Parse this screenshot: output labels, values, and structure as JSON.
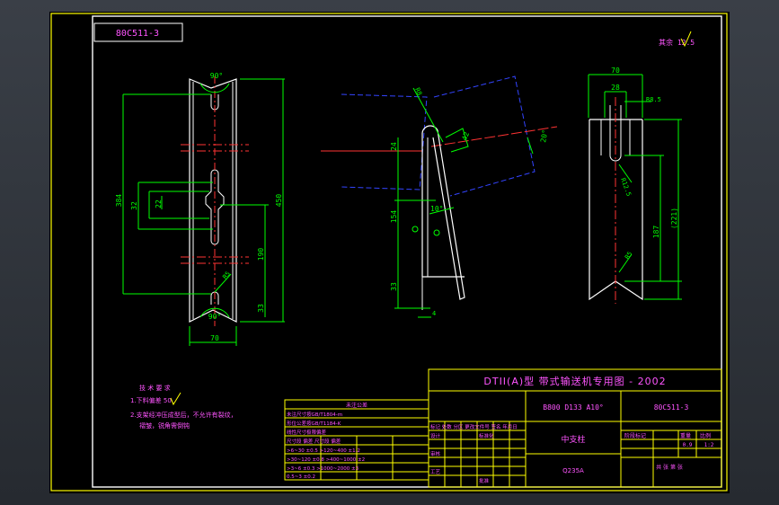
{
  "sheet": {
    "code_mirrored": "80C511-3",
    "roughness_note": "其余 12.5"
  },
  "front_view": {
    "angle_top": "90°",
    "angle_bottom": "90°",
    "width": "70",
    "hole_span": "384",
    "total_height": "450",
    "slot_width": "32",
    "slot_inner": "22",
    "lower_span": "190",
    "bottom_offset": "33",
    "radius": "R5"
  },
  "side_view": {
    "radius": "R8",
    "dim_24": "24",
    "dim_154": "154",
    "dim_33": "33",
    "angle_10": "10°",
    "dim_4": "4",
    "dim_42": "42",
    "angle_20": "20°"
  },
  "end_view": {
    "width": "70",
    "slot": "28",
    "r_top": "R8.5",
    "r_mid": "R12.5",
    "dim_187": "187",
    "dim_221": "(221)",
    "r_bottom": "R5"
  },
  "tech_req": {
    "title": "技 术 要 求",
    "line1": "1.下料偏差 50",
    "line2": "2.支架经冲压成型后，不允许有裂纹，",
    "line3": "  褶皱，锐角需倒钝"
  },
  "tolerance": {
    "title": "未注公差",
    "note1": "未注尺寸按GB/T1804-m",
    "note2": "形位公差按GB/T1184-K",
    "note3": "线性尺寸极限偏差",
    "header": "尺寸段  偏差  尺寸段  偏差",
    "row1": ">6~30   ±0.5  >120~400  ±1.2",
    "row2": ">30~120 ±0.8  >400~1000 ±2",
    "row3": ">3~6    ±0.3  >1000~2000 ±3",
    "row4": "0.5~3   ±0.2"
  },
  "title_block": {
    "heading": "DTII(A)型  带式输送机专用图 - 2002",
    "spec": "B800 D133 A10°",
    "code": "80C511-3",
    "part_name": "中支柱",
    "material": "Q235A",
    "sign_label": "标记 处数 分区 更改文件号 签名 年月日",
    "design_label": "设计",
    "check_label": "审核",
    "process_label": "工艺",
    "std_label": "标准化",
    "approve_label": "批准",
    "stage_label": "阶段标记",
    "weight_label": "重量",
    "scale_label": "比例",
    "weight": "0.9",
    "scale": "1:2",
    "sheets": "共  张   第  张"
  }
}
